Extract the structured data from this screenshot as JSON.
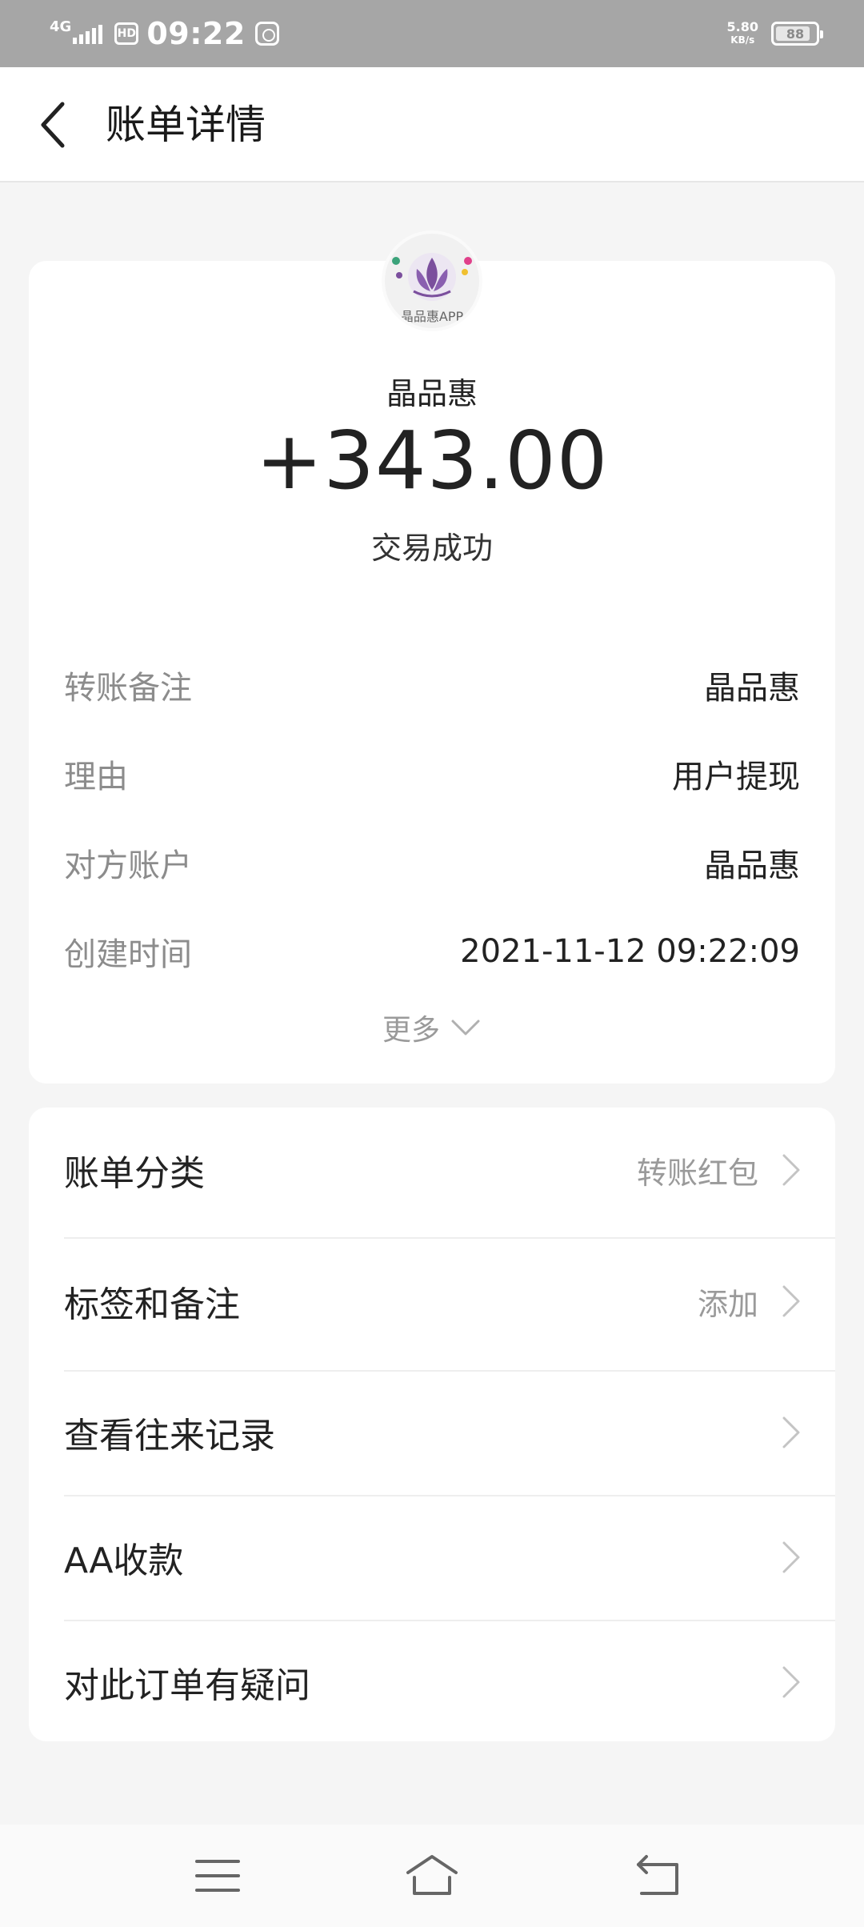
{
  "status_bar": {
    "network": "4G",
    "hd_badge": "HD",
    "time": "09:22",
    "net_speed": "5.80",
    "net_speed_unit": "KB/s",
    "battery": "88"
  },
  "header": {
    "title": "账单详情",
    "back_icon": "chevron-left-icon"
  },
  "summary": {
    "logo_caption": "晶品惠APP",
    "merchant_name": "晶品惠",
    "amount": "+343.00",
    "status": "交易成功",
    "details": [
      {
        "label": "转账备注",
        "value": "晶品惠"
      },
      {
        "label": "理由",
        "value": "用户提现"
      },
      {
        "label": "对方账户",
        "value": "晶品惠"
      },
      {
        "label": "创建时间",
        "value": "2021-11-12 09:22:09"
      }
    ],
    "more_label": "更多"
  },
  "actions": [
    {
      "label": "账单分类",
      "value": "转账红包"
    },
    {
      "label": "标签和备注",
      "value": "添加"
    },
    {
      "label": "查看往来记录",
      "value": ""
    },
    {
      "label": "AA收款",
      "value": ""
    },
    {
      "label": "对此订单有疑问",
      "value": ""
    }
  ],
  "nav": {
    "menu_icon": "menu-icon",
    "home_icon": "home-icon",
    "back_icon": "back-icon"
  },
  "colors": {
    "status_bar_bg": "#a6a6a6",
    "page_bg": "#f5f5f5",
    "card_bg": "#ffffff",
    "logo_purple": "#7b4f9d"
  }
}
